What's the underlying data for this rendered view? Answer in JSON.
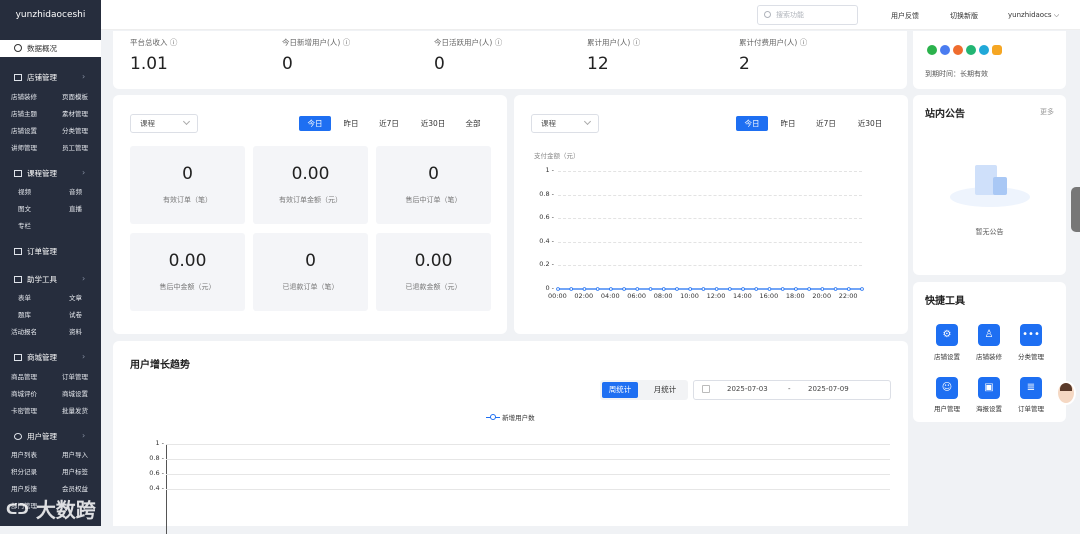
{
  "app": {
    "title": "yunzhidaoceshi"
  },
  "sidebar": {
    "active": "数据概况",
    "sections": [
      {
        "label": "店铺管理",
        "items": [
          "店铺装修",
          "页面模板",
          "店铺主题",
          "素材管理",
          "店铺设置",
          "分类管理",
          "讲师管理",
          "员工管理"
        ]
      },
      {
        "label": "课程管理",
        "items": [
          "视频",
          "音频",
          "图文",
          "直播",
          "专栏"
        ]
      },
      {
        "label": "订单管理",
        "items": []
      },
      {
        "label": "助学工具",
        "items": [
          "表单",
          "文章",
          "题库",
          "试卷",
          "活动报名",
          "资料"
        ]
      },
      {
        "label": "商城管理",
        "items": [
          "商品管理",
          "订单管理",
          "商城评价",
          "商城设置",
          "卡密管理",
          "批量发货"
        ]
      },
      {
        "label": "用户管理",
        "items": [
          "用户列表",
          "用户导入",
          "积分记录",
          "用户标签",
          "用户反馈",
          "会员权益",
          "",
          "部门管理"
        ]
      }
    ]
  },
  "header": {
    "search_placeholder": "搜索功能",
    "links": [
      "用户反馈",
      "切换新版"
    ],
    "user": "yunzhidaocs"
  },
  "stats": [
    {
      "label": "平台总收入",
      "value": "1.01"
    },
    {
      "label": "今日新增用户(人)",
      "value": "0"
    },
    {
      "label": "今日活跃用户(人)",
      "value": "0"
    },
    {
      "label": "累计用户(人)",
      "value": "12"
    },
    {
      "label": "累计付费用户(人)",
      "value": "2"
    }
  ],
  "account": {
    "expiry": "到期时间：长期有效",
    "partial_text": "…"
  },
  "orders_panel": {
    "select": "课程",
    "tabs": [
      "今日",
      "昨日",
      "近7日",
      "近30日",
      "全部"
    ],
    "boxes": [
      {
        "value": "0",
        "label": "有效订单（笔）"
      },
      {
        "value": "0.00",
        "label": "有效订单金额（元）"
      },
      {
        "value": "0",
        "label": "售后中订单（笔）"
      },
      {
        "value": "0.00",
        "label": "售后中金额（元）"
      },
      {
        "value": "0",
        "label": "已退款订单（笔）"
      },
      {
        "value": "0.00",
        "label": "已退款金额（元）"
      }
    ]
  },
  "payment_chart": {
    "select": "课程",
    "tabs": [
      "今日",
      "昨日",
      "近7日",
      "近30日"
    ],
    "chart_data": {
      "type": "line",
      "ylabel": "支付金额（元）",
      "ylim": [
        0,
        1
      ],
      "yticks": [
        "1",
        "0.8",
        "0.6",
        "0.4",
        "0.2",
        "0"
      ],
      "x": [
        "00:00",
        "01:00",
        "02:00",
        "03:00",
        "04:00",
        "05:00",
        "06:00",
        "07:00",
        "08:00",
        "09:00",
        "10:00",
        "11:00",
        "12:00",
        "13:00",
        "14:00",
        "15:00",
        "16:00",
        "17:00",
        "18:00",
        "19:00",
        "20:00",
        "21:00",
        "22:00",
        "23:00"
      ],
      "xticks": [
        "00:00",
        "02:00",
        "04:00",
        "06:00",
        "08:00",
        "10:00",
        "12:00",
        "14:00",
        "16:00",
        "18:00",
        "20:00",
        "22:00"
      ],
      "series": [
        {
          "values": [
            0,
            0,
            0,
            0,
            0,
            0,
            0,
            0,
            0,
            0,
            0,
            0,
            0,
            0,
            0,
            0,
            0,
            0,
            0,
            0,
            0,
            0,
            0,
            0
          ]
        }
      ],
      "color": "#1e6ff2"
    }
  },
  "growth": {
    "title": "用户增长趋势",
    "tabs": [
      "周统计",
      "月统计"
    ],
    "date_start": "2025-07-03",
    "date_sep": "-",
    "date_end": "2025-07-09",
    "chart_data": {
      "type": "line",
      "series": [
        {
          "name": "新增用户数",
          "values": []
        }
      ],
      "yticks": [
        "1",
        "0.8",
        "0.6",
        "0.4"
      ],
      "ylim": [
        0,
        1
      ]
    }
  },
  "notice": {
    "title": "站内公告",
    "more": "更多",
    "empty": "暂无公告"
  },
  "quick_tools": {
    "title": "快捷工具",
    "items": [
      {
        "label": "店铺设置",
        "icon": "gear-icon"
      },
      {
        "label": "店铺装修",
        "icon": "shirt-icon"
      },
      {
        "label": "分类管理",
        "icon": "dots-icon"
      },
      {
        "label": "用户管理",
        "icon": "user-icon"
      },
      {
        "label": "海报设置",
        "icon": "image-icon"
      },
      {
        "label": "订单管理",
        "icon": "document-icon"
      }
    ]
  },
  "watermark": "大数跨境"
}
